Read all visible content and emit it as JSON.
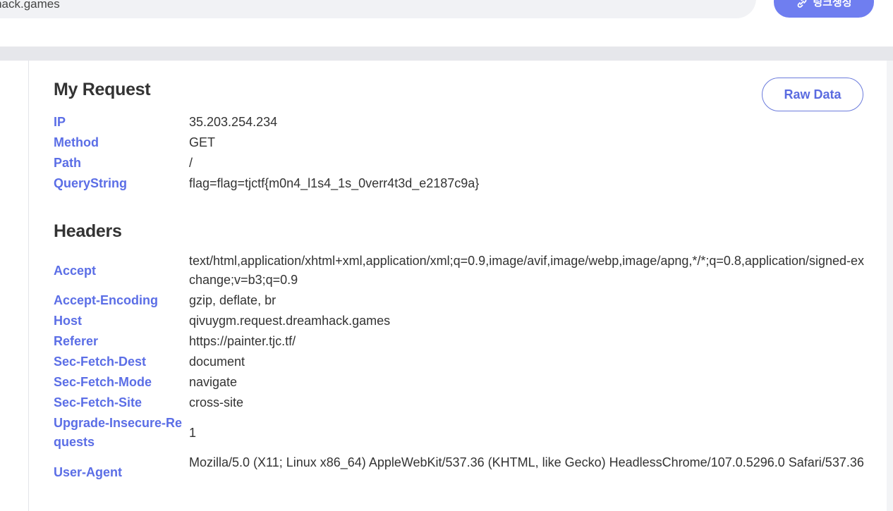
{
  "top": {
    "url_text": "eamhack.games",
    "link_button_label": "링크생성"
  },
  "my_request": {
    "title": "My Request",
    "raw_button": "Raw Data",
    "rows": [
      {
        "key": "IP",
        "value": "35.203.254.234"
      },
      {
        "key": "Method",
        "value": "GET"
      },
      {
        "key": "Path",
        "value": "/"
      },
      {
        "key": "QueryString",
        "value": "flag=flag=tjctf{m0n4_l1s4_1s_0verr4t3d_e2187c9a}"
      }
    ]
  },
  "headers": {
    "title": "Headers",
    "rows": [
      {
        "key": "Accept",
        "value": "text/html,application/xhtml+xml,application/xml;q=0.9,image/avif,image/webp,image/apng,*/*;q=0.8,application/signed-exchange;v=b3;q=0.9"
      },
      {
        "key": "Accept-Encoding",
        "value": "gzip, deflate, br"
      },
      {
        "key": "Host",
        "value": "qivuygm.request.dreamhack.games"
      },
      {
        "key": "Referer",
        "value": "https://painter.tjc.tf/"
      },
      {
        "key": "Sec-Fetch-Dest",
        "value": "document"
      },
      {
        "key": "Sec-Fetch-Mode",
        "value": "navigate"
      },
      {
        "key": "Sec-Fetch-Site",
        "value": "cross-site"
      },
      {
        "key": "Upgrade-Insecure-Requests",
        "value": "1"
      },
      {
        "key": "User-Agent",
        "value": "Mozilla/5.0 (X11; Linux x86_64) AppleWebKit/537.36 (KHTML, like Gecko) HeadlessChrome/107.0.5296.0 Safari/537.36"
      }
    ]
  }
}
